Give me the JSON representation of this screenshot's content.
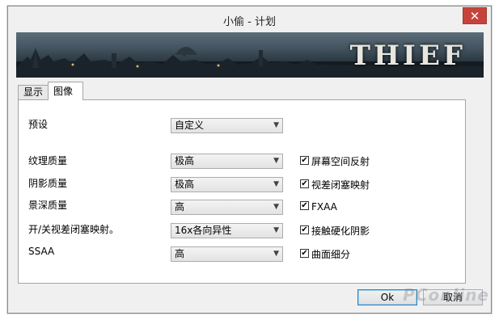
{
  "window": {
    "title": "小偷 - 计划",
    "close_glyph": "✕"
  },
  "banner": {
    "logo_text": "THIEF"
  },
  "tabs": [
    {
      "label": "显示",
      "active": false
    },
    {
      "label": "图像",
      "active": true
    }
  ],
  "preset": {
    "label": "预设",
    "value": "自定义"
  },
  "settings": [
    {
      "label": "纹理质量",
      "value": "极高"
    },
    {
      "label": "阴影质量",
      "value": "极高"
    },
    {
      "label": "景深质量",
      "value": "高"
    },
    {
      "label": "开/关视差闭塞映射。",
      "value": "16x各向异性"
    },
    {
      "label": "SSAA",
      "value": "高"
    }
  ],
  "checkboxes": [
    {
      "label": "屏幕空间反射",
      "checked": true
    },
    {
      "label": "视差闭塞映射",
      "checked": true
    },
    {
      "label": "FXAA",
      "checked": true
    },
    {
      "label": "接触硬化阴影",
      "checked": true
    },
    {
      "label": "曲面细分",
      "checked": true
    }
  ],
  "buttons": {
    "ok": "Ok",
    "cancel": "取消"
  },
  "watermark": "PConline",
  "colors": {
    "close_red": "#c6433c",
    "window_bg": "#f0f0f0"
  }
}
